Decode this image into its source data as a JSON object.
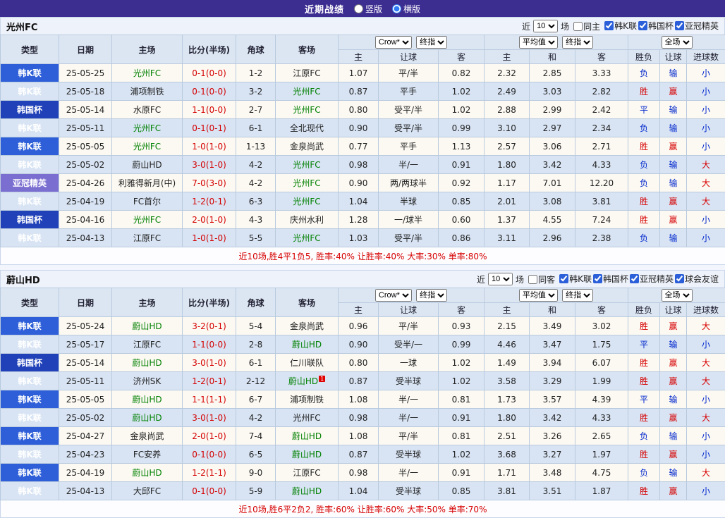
{
  "colors": {
    "topbar_bg": "#3c2d91",
    "league_krleague_bg": "#2e5fd8",
    "league_krcup_bg": "#2041b8",
    "league_acl_bg": "#7a6ed0",
    "score_text": "#d40000",
    "team_highlight": "#008000",
    "result_red": "#d60000",
    "result_blue": "#0026cc",
    "row_bg": "#fcf9f2",
    "row_alt_bg": "#d8e4f4",
    "header_bg": "#dce6f3"
  },
  "topbar": {
    "title": "近期战绩",
    "radios": [
      {
        "label": "竖版",
        "checked": false
      },
      {
        "label": "横版",
        "checked": true
      }
    ]
  },
  "columns": {
    "type": "类型",
    "date": "日期",
    "home": "主场",
    "score": "比分(半场)",
    "corner": "角球",
    "away": "客场",
    "odds_book": "Crow*",
    "odds_final": "终指",
    "avg": "平均值",
    "avg_final": "终指",
    "full": "全场",
    "sub": [
      "主",
      "让球",
      "客",
      "主",
      "和",
      "客",
      "胜负",
      "让球",
      "进球数"
    ]
  },
  "sections": [
    {
      "team": "光州FC",
      "filter": {
        "near": "近",
        "count": "10",
        "field": "场",
        "same_label": "同主",
        "same_checked": false,
        "leagues": [
          {
            "label": "韩K联",
            "checked": true
          },
          {
            "label": "韩国杯",
            "checked": true
          },
          {
            "label": "亚冠精英",
            "checked": true
          }
        ]
      },
      "rows": [
        {
          "lg": "韩K联",
          "date": "25-05-25",
          "home": "光州FC",
          "hg": 1,
          "score": "0-1(0-0)",
          "corner": "1-2",
          "away": "江原FC",
          "odds": [
            "1.07",
            "平/半",
            "0.82"
          ],
          "avg": [
            "2.32",
            "2.85",
            "3.33"
          ],
          "res": [
            [
              "负",
              "b"
            ],
            [
              "输",
              "b"
            ],
            [
              "小",
              "b"
            ]
          ]
        },
        {
          "lg": "韩K联",
          "date": "25-05-18",
          "home": "浦项制铁",
          "score": "0-1(0-0)",
          "corner": "3-2",
          "away": "光州FC",
          "ag": 1,
          "odds": [
            "0.87",
            "平手",
            "1.02"
          ],
          "avg": [
            "2.49",
            "3.03",
            "2.82"
          ],
          "res": [
            [
              "胜",
              "r"
            ],
            [
              "赢",
              "r"
            ],
            [
              "小",
              "b"
            ]
          ]
        },
        {
          "lg": "韩国杯",
          "date": "25-05-14",
          "home": "水原FC",
          "score": "1-1(0-0)",
          "corner": "2-7",
          "away": "光州FC",
          "ag": 1,
          "odds": [
            "0.80",
            "受平/半",
            "1.02"
          ],
          "avg": [
            "2.88",
            "2.99",
            "2.42"
          ],
          "res": [
            [
              "平",
              "b"
            ],
            [
              "输",
              "b"
            ],
            [
              "小",
              "b"
            ]
          ]
        },
        {
          "lg": "韩K联",
          "date": "25-05-11",
          "home": "光州FC",
          "hg": 1,
          "score": "0-1(0-1)",
          "corner": "6-1",
          "away": "全北现代",
          "odds": [
            "0.90",
            "受平/半",
            "0.99"
          ],
          "avg": [
            "3.10",
            "2.97",
            "2.34"
          ],
          "res": [
            [
              "负",
              "b"
            ],
            [
              "输",
              "b"
            ],
            [
              "小",
              "b"
            ]
          ]
        },
        {
          "lg": "韩K联",
          "date": "25-05-05",
          "home": "光州FC",
          "hg": 1,
          "score": "1-0(1-0)",
          "corner": "1-13",
          "away": "金泉尚武",
          "odds": [
            "0.77",
            "平手",
            "1.13"
          ],
          "avg": [
            "2.57",
            "3.06",
            "2.71"
          ],
          "res": [
            [
              "胜",
              "r"
            ],
            [
              "赢",
              "r"
            ],
            [
              "小",
              "b"
            ]
          ]
        },
        {
          "lg": "韩K联",
          "date": "25-05-02",
          "home": "蔚山HD",
          "score": "3-0(1-0)",
          "corner": "4-2",
          "away": "光州FC",
          "ag": 1,
          "odds": [
            "0.98",
            "半/一",
            "0.91"
          ],
          "avg": [
            "1.80",
            "3.42",
            "4.33"
          ],
          "res": [
            [
              "负",
              "b"
            ],
            [
              "输",
              "b"
            ],
            [
              "大",
              "r"
            ]
          ]
        },
        {
          "lg": "亚冠精英",
          "date": "25-04-26",
          "home": "利雅得新月(中)",
          "score": "7-0(3-0)",
          "corner": "4-2",
          "away": "光州FC",
          "ag": 1,
          "odds": [
            "0.90",
            "两/两球半",
            "0.92"
          ],
          "avg": [
            "1.17",
            "7.01",
            "12.20"
          ],
          "res": [
            [
              "负",
              "b"
            ],
            [
              "输",
              "b"
            ],
            [
              "大",
              "r"
            ]
          ]
        },
        {
          "lg": "韩K联",
          "date": "25-04-19",
          "home": "FC首尔",
          "score": "1-2(0-1)",
          "corner": "6-3",
          "away": "光州FC",
          "ag": 1,
          "odds": [
            "1.04",
            "半球",
            "0.85"
          ],
          "avg": [
            "2.01",
            "3.08",
            "3.81"
          ],
          "res": [
            [
              "胜",
              "r"
            ],
            [
              "赢",
              "r"
            ],
            [
              "大",
              "r"
            ]
          ]
        },
        {
          "lg": "韩国杯",
          "date": "25-04-16",
          "home": "光州FC",
          "hg": 1,
          "score": "2-0(1-0)",
          "corner": "4-3",
          "away": "庆州水利",
          "odds": [
            "1.28",
            "一/球半",
            "0.60"
          ],
          "avg": [
            "1.37",
            "4.55",
            "7.24"
          ],
          "res": [
            [
              "胜",
              "r"
            ],
            [
              "赢",
              "r"
            ],
            [
              "小",
              "b"
            ]
          ]
        },
        {
          "lg": "韩K联",
          "date": "25-04-13",
          "home": "江原FC",
          "score": "1-0(1-0)",
          "corner": "5-5",
          "away": "光州FC",
          "ag": 1,
          "odds": [
            "1.03",
            "受平/半",
            "0.86"
          ],
          "avg": [
            "3.11",
            "2.96",
            "2.38"
          ],
          "res": [
            [
              "负",
              "b"
            ],
            [
              "输",
              "b"
            ],
            [
              "小",
              "b"
            ]
          ]
        }
      ],
      "summary": "近10场,胜4平1负5, 胜率:40% 让胜率:40% 大率:30% 单率:80%"
    },
    {
      "team": "蔚山HD",
      "filter": {
        "near": "近",
        "count": "10",
        "field": "场",
        "same_label": "同客",
        "same_checked": false,
        "leagues": [
          {
            "label": "韩K联",
            "checked": true
          },
          {
            "label": "韩国杯",
            "checked": true
          },
          {
            "label": "亚冠精英",
            "checked": true
          },
          {
            "label": "球会友谊",
            "checked": true
          }
        ]
      },
      "rows": [
        {
          "lg": "韩K联",
          "date": "25-05-24",
          "home": "蔚山HD",
          "hg": 1,
          "score": "3-2(0-1)",
          "corner": "5-4",
          "away": "金泉尚武",
          "odds": [
            "0.96",
            "平/半",
            "0.93"
          ],
          "avg": [
            "2.15",
            "3.49",
            "3.02"
          ],
          "res": [
            [
              "胜",
              "r"
            ],
            [
              "赢",
              "r"
            ],
            [
              "大",
              "r"
            ]
          ]
        },
        {
          "lg": "韩K联",
          "date": "25-05-17",
          "home": "江原FC",
          "score": "1-1(0-0)",
          "corner": "2-8",
          "away": "蔚山HD",
          "ag": 1,
          "odds": [
            "0.90",
            "受半/一",
            "0.99"
          ],
          "avg": [
            "4.46",
            "3.47",
            "1.75"
          ],
          "res": [
            [
              "平",
              "b"
            ],
            [
              "输",
              "b"
            ],
            [
              "小",
              "b"
            ]
          ]
        },
        {
          "lg": "韩国杯",
          "date": "25-05-14",
          "home": "蔚山HD",
          "hg": 1,
          "score": "3-0(1-0)",
          "corner": "6-1",
          "away": "仁川联队",
          "odds": [
            "0.80",
            "一球",
            "1.02"
          ],
          "avg": [
            "1.49",
            "3.94",
            "6.07"
          ],
          "res": [
            [
              "胜",
              "r"
            ],
            [
              "赢",
              "r"
            ],
            [
              "大",
              "r"
            ]
          ]
        },
        {
          "lg": "韩K联",
          "date": "25-05-11",
          "home": "济州SK",
          "score": "1-2(0-1)",
          "corner": "2-12",
          "away": "蔚山HD",
          "ag": 1,
          "badge": "1",
          "odds": [
            "0.87",
            "受半球",
            "1.02"
          ],
          "avg": [
            "3.58",
            "3.29",
            "1.99"
          ],
          "res": [
            [
              "胜",
              "r"
            ],
            [
              "赢",
              "r"
            ],
            [
              "大",
              "r"
            ]
          ]
        },
        {
          "lg": "韩K联",
          "date": "25-05-05",
          "home": "蔚山HD",
          "hg": 1,
          "score": "1-1(1-1)",
          "corner": "6-7",
          "away": "浦项制铁",
          "odds": [
            "1.08",
            "半/一",
            "0.81"
          ],
          "avg": [
            "1.73",
            "3.57",
            "4.39"
          ],
          "res": [
            [
              "平",
              "b"
            ],
            [
              "输",
              "b"
            ],
            [
              "小",
              "b"
            ]
          ]
        },
        {
          "lg": "韩K联",
          "date": "25-05-02",
          "home": "蔚山HD",
          "hg": 1,
          "score": "3-0(1-0)",
          "corner": "4-2",
          "away": "光州FC",
          "odds": [
            "0.98",
            "半/一",
            "0.91"
          ],
          "avg": [
            "1.80",
            "3.42",
            "4.33"
          ],
          "res": [
            [
              "胜",
              "r"
            ],
            [
              "赢",
              "r"
            ],
            [
              "大",
              "r"
            ]
          ]
        },
        {
          "lg": "韩K联",
          "date": "25-04-27",
          "home": "金泉尚武",
          "score": "2-0(1-0)",
          "corner": "7-4",
          "away": "蔚山HD",
          "ag": 1,
          "odds": [
            "1.08",
            "平/半",
            "0.81"
          ],
          "avg": [
            "2.51",
            "3.26",
            "2.65"
          ],
          "res": [
            [
              "负",
              "b"
            ],
            [
              "输",
              "b"
            ],
            [
              "小",
              "b"
            ]
          ]
        },
        {
          "lg": "韩K联",
          "date": "25-04-23",
          "home": "FC安养",
          "score": "0-1(0-0)",
          "corner": "6-5",
          "away": "蔚山HD",
          "ag": 1,
          "odds": [
            "0.87",
            "受半球",
            "1.02"
          ],
          "avg": [
            "3.68",
            "3.27",
            "1.97"
          ],
          "res": [
            [
              "胜",
              "r"
            ],
            [
              "赢",
              "r"
            ],
            [
              "小",
              "b"
            ]
          ]
        },
        {
          "lg": "韩K联",
          "date": "25-04-19",
          "home": "蔚山HD",
          "hg": 1,
          "score": "1-2(1-1)",
          "corner": "9-0",
          "away": "江原FC",
          "odds": [
            "0.98",
            "半/一",
            "0.91"
          ],
          "avg": [
            "1.71",
            "3.48",
            "4.75"
          ],
          "res": [
            [
              "负",
              "b"
            ],
            [
              "输",
              "b"
            ],
            [
              "大",
              "r"
            ]
          ]
        },
        {
          "lg": "韩K联",
          "date": "25-04-13",
          "home": "大邱FC",
          "score": "0-1(0-0)",
          "corner": "5-9",
          "away": "蔚山HD",
          "ag": 1,
          "odds": [
            "1.04",
            "受半球",
            "0.85"
          ],
          "avg": [
            "3.81",
            "3.51",
            "1.87"
          ],
          "res": [
            [
              "胜",
              "r"
            ],
            [
              "赢",
              "r"
            ],
            [
              "小",
              "b"
            ]
          ]
        }
      ],
      "summary": "近10场,胜6平2负2, 胜率:60% 让胜率:60% 大率:50% 单率:70%"
    }
  ]
}
